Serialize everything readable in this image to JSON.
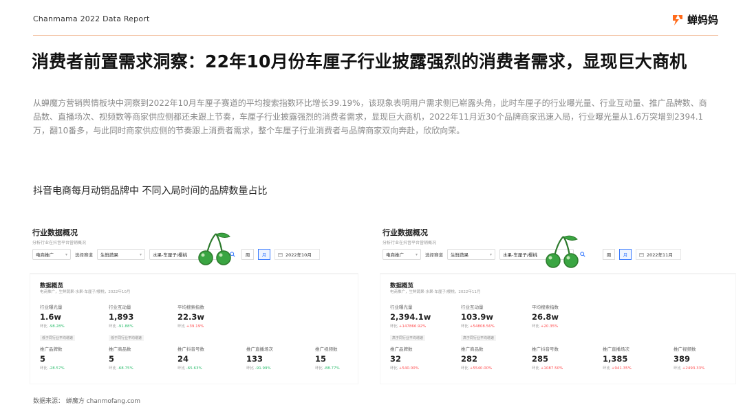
{
  "header": {
    "report_name": "Chanmama 2022 Data Report",
    "brand_name": "蝉妈妈",
    "accent_color": "#ff6a1a",
    "logo_icon": "cicada-logo-icon"
  },
  "headline": "消费者前置需求洞察：22年10月份车厘子行业披露强烈的消费者需求，显现巨大商机",
  "paragraph": "从蝉魔方营销舆情板块中洞察到2022年10月车厘子赛道的平均搜索指数环比增长39.19%，该现象表明用户需求侧已崭露头角，此时车厘子的行业曝光量、行业互动量、推广品牌数、商品数、直播场次、视频数等商家供应侧都还未跟上节奏，车厘子行业披露强烈的消费者需求，显现巨大商机，2022年11月近30个品牌商家迅速入局，行业曝光量从1.6万突增到2394.1万，翻10番多，与此同时商家供应侧的节奏跟上消费者需求，整个车厘子行业消费者与品牌商家双向奔赴，欣欣向荣。",
  "subtitle": "抖音电商每月动销品牌中  不同入局时间的品牌数量占比",
  "panels": [
    {
      "title": "行业数据概况",
      "subtitle": "分析行业在抖音平台营销概况",
      "filters": {
        "channel": "电商推广",
        "track_label": "选择赛道",
        "track": "生鲜蔬果",
        "category": "水果-车厘子/樱桃",
        "week": "周",
        "month": "月",
        "date": "2022年10月"
      },
      "card_title": "数据概览",
      "card_sub": "电商推广，生鲜蔬果-水果-车厘子/樱桃，2022年10月",
      "metrics_top": [
        {
          "label": "行业曝光量",
          "value": "1.6w",
          "change_prefix": "环比",
          "change": "-98.28%",
          "dir": "down",
          "tag": "低于同行业平均增速"
        },
        {
          "label": "行业互动量",
          "value": "1,893",
          "change_prefix": "环比",
          "change": "-91.88%",
          "dir": "down",
          "tag": "低于同行业平均增速"
        },
        {
          "label": "平均搜索指数",
          "value": "22.3w",
          "change_prefix": "环比",
          "change": "+39.19%",
          "dir": "up",
          "tag": ""
        }
      ],
      "metrics_bottom": [
        {
          "label": "推广品牌数",
          "value": "5",
          "change_prefix": "环比",
          "change": "-28.57%",
          "dir": "down"
        },
        {
          "label": "推广商品数",
          "value": "5",
          "change_prefix": "环比",
          "change": "-68.75%",
          "dir": "down"
        },
        {
          "label": "推广抖音号数",
          "value": "24",
          "change_prefix": "环比",
          "change": "-65.63%",
          "dir": "down"
        },
        {
          "label": "推广直播场次",
          "value": "133",
          "change_prefix": "环比",
          "change": "-91.99%",
          "dir": "down"
        },
        {
          "label": "推广视频数",
          "value": "15",
          "change_prefix": "环比",
          "change": "-88.77%",
          "dir": "down"
        }
      ]
    },
    {
      "title": "行业数据概况",
      "subtitle": "分析行业在抖音平台营销概况",
      "filters": {
        "channel": "电商推广",
        "track_label": "选择赛道",
        "track": "生鲜蔬果",
        "category": "水果-车厘子/樱桃",
        "week": "周",
        "month": "月",
        "date": "2022年11月"
      },
      "card_title": "数据概览",
      "card_sub": "电商推广，生鲜蔬果-水果-车厘子/樱桃，2022年11月",
      "metrics_top": [
        {
          "label": "行业曝光量",
          "value": "2,394.1w",
          "change_prefix": "环比",
          "change": "+147866.92%",
          "dir": "up",
          "tag": "高于同行业平均增速"
        },
        {
          "label": "行业互动量",
          "value": "103.9w",
          "change_prefix": "环比",
          "change": "+54808.56%",
          "dir": "up",
          "tag": "高于同行业平均增速"
        },
        {
          "label": "平均搜索指数",
          "value": "26.8w",
          "change_prefix": "环比",
          "change": "+20.35%",
          "dir": "up",
          "tag": ""
        }
      ],
      "metrics_bottom": [
        {
          "label": "推广品牌数",
          "value": "32",
          "change_prefix": "环比",
          "change": "+540.00%",
          "dir": "up"
        },
        {
          "label": "推广商品数",
          "value": "282",
          "change_prefix": "环比",
          "change": "+5540.00%",
          "dir": "up"
        },
        {
          "label": "推广抖音号数",
          "value": "285",
          "change_prefix": "环比",
          "change": "+1087.50%",
          "dir": "up"
        },
        {
          "label": "推广直播场次",
          "value": "1,385",
          "change_prefix": "环比",
          "change": "+941.35%",
          "dir": "up"
        },
        {
          "label": "推广视频数",
          "value": "389",
          "change_prefix": "环比",
          "change": "+2493.33%",
          "dir": "up"
        }
      ]
    }
  ],
  "source": "数据来源：  蝉魔方 chanmofang.com",
  "colors": {
    "down": "#2ebd6e",
    "up": "#ff4d4f",
    "cherry": "#3aa542",
    "stem": "#2d7a2d"
  },
  "icons": {
    "cherry": "cherry-icon",
    "search": "search-icon",
    "calendar": "calendar-icon",
    "chevron": "chevron-down-icon"
  }
}
